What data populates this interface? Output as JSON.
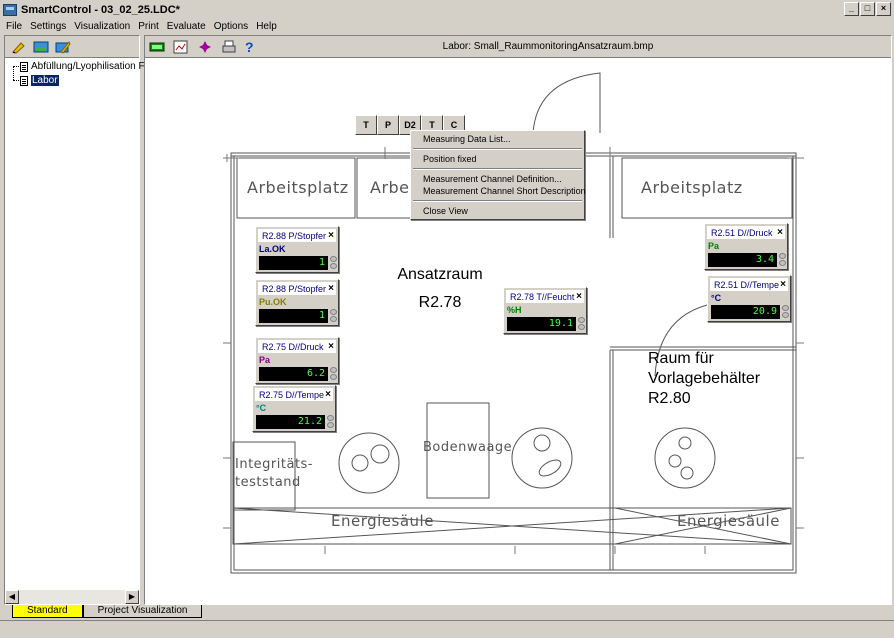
{
  "window": {
    "title": "SmartControl - 03_02_25.LDC*"
  },
  "menu": [
    "File",
    "Settings",
    "Visualization",
    "Print",
    "Evaluate",
    "Options",
    "Help"
  ],
  "tree": {
    "items": [
      "Abfüllung/Lyophilisation F",
      "Labor"
    ]
  },
  "main": {
    "header": "Labor:  Small_RaummonitoringAnsatzraum.bmp"
  },
  "tags": [
    "T",
    "P",
    "D2",
    "T",
    "C"
  ],
  "context_menu": {
    "items": [
      "Measuring Data List...",
      "Position fixed",
      "Measurement Channel Definition...",
      "Measurement Channel Short Description",
      "Close View"
    ]
  },
  "plan": {
    "arbeitsplatz1": "Arbeitsplatz",
    "arbeitsplatz2": "Arbei",
    "arbeitsplatz3": "Arbeitsplatz",
    "ansatzraum": "Ansatzraum",
    "ansatzraum_no": "R2.78",
    "raum": "Raum für",
    "vorlage": "Vorlagebehälter",
    "raum_no": "R2.80",
    "integritaet1": "Integritäts-",
    "integritaet2": "teststand",
    "bodenwaage": "Bodenwaage",
    "energie1": "Energiesäule",
    "energie2": "Energiesäule"
  },
  "widgets": [
    {
      "title": "R2.88 P/Stopfer",
      "unit": "La.OK",
      "value": "1",
      "unit_color": "#000080"
    },
    {
      "title": "R2.88 P/Stopfer",
      "unit": "Pu.OK",
      "value": "1",
      "unit_color": "#808000"
    },
    {
      "title": "R2.75 D//Druck",
      "unit": "Pa",
      "value": "6.2",
      "unit_color": "#800080"
    },
    {
      "title": "R2.75 D//Tempe",
      "unit": "°C",
      "value": "21.2",
      "unit_color": "#008080"
    },
    {
      "title": "R2.78 T//Feucht",
      "unit": "%H",
      "value": "19.1",
      "unit_color": "#008000"
    },
    {
      "title": "R2.51 D//Druck",
      "unit": "Pa",
      "value": "3.4",
      "unit_color": "#008000"
    },
    {
      "title": "R2.51 D//Tempe",
      "unit": "°C",
      "value": "20.9",
      "unit_color": "#000080"
    }
  ],
  "tabs": [
    "Standard",
    "Project Visualization"
  ],
  "colors": {
    "selection": "#0a246a",
    "tab_active": "#ffff00",
    "display_text": "#4cff4c"
  }
}
